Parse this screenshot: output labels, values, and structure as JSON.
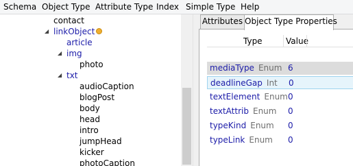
{
  "menu": [
    "Schema",
    "Object Type",
    "Attribute Type",
    "Index",
    "Simple Type",
    "Help"
  ],
  "tree": {
    "contact": "contact",
    "linkObject": "linkObject",
    "article": "article",
    "img": "img",
    "photo": "photo",
    "txt": "txt",
    "txt_children": [
      "audioCaption",
      "blogPost",
      "body",
      "head",
      "intro",
      "jumpHead",
      "kicker",
      "photoCaption"
    ]
  },
  "tabs": [
    "Attributes",
    "Object Type Properties"
  ],
  "grid": {
    "col_type": "Type",
    "col_value": "Value",
    "rows": [
      {
        "name": "mediaType",
        "type": "Enum",
        "value": "6"
      },
      {
        "name": "deadlineGap",
        "type": "Int",
        "value": "0"
      },
      {
        "name": "textElement",
        "type": "Enum",
        "value": "0"
      },
      {
        "name": "textAttrib",
        "type": "Enum",
        "value": "0"
      },
      {
        "name": "typeKind",
        "type": "Enum",
        "value": "0"
      },
      {
        "name": "typeLink",
        "type": "Enum",
        "value": "0"
      }
    ]
  }
}
